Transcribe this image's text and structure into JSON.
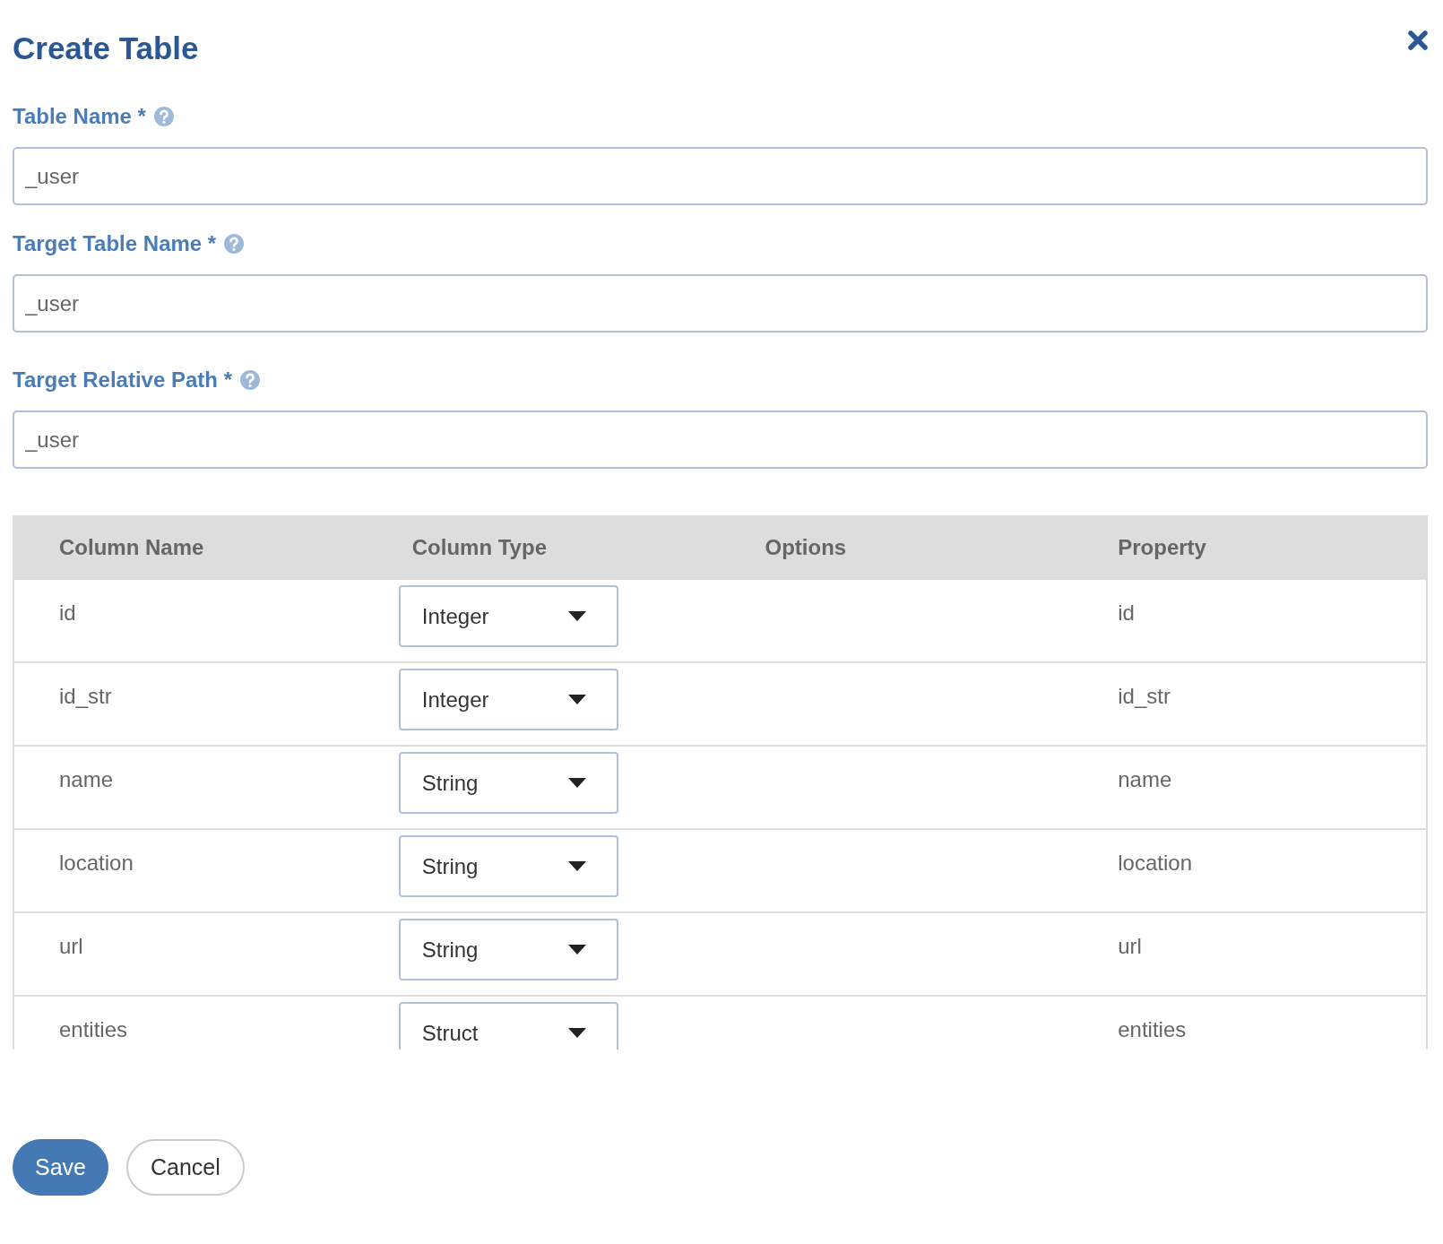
{
  "dialog": {
    "title": "Create Table"
  },
  "fields": [
    {
      "label": "Table Name *",
      "value": "_user"
    },
    {
      "label": "Target Table Name *",
      "value": "_user"
    },
    {
      "label": "Target Relative Path *",
      "value": "_user"
    }
  ],
  "table": {
    "columns": [
      "Column Name",
      "Column Type",
      "Options",
      "Property"
    ],
    "rows": [
      {
        "name": "id",
        "type": "Integer",
        "property": "id"
      },
      {
        "name": "id_str",
        "type": "Integer",
        "property": "id_str"
      },
      {
        "name": "name",
        "type": "String",
        "property": "name"
      },
      {
        "name": "location",
        "type": "String",
        "property": "location"
      },
      {
        "name": "url",
        "type": "String",
        "property": "url"
      },
      {
        "name": "entities",
        "type": "Struct",
        "property": "entities"
      }
    ]
  },
  "buttons": [
    {
      "label": "Save",
      "kind": "primary"
    },
    {
      "label": "Cancel",
      "kind": "secondary"
    }
  ]
}
